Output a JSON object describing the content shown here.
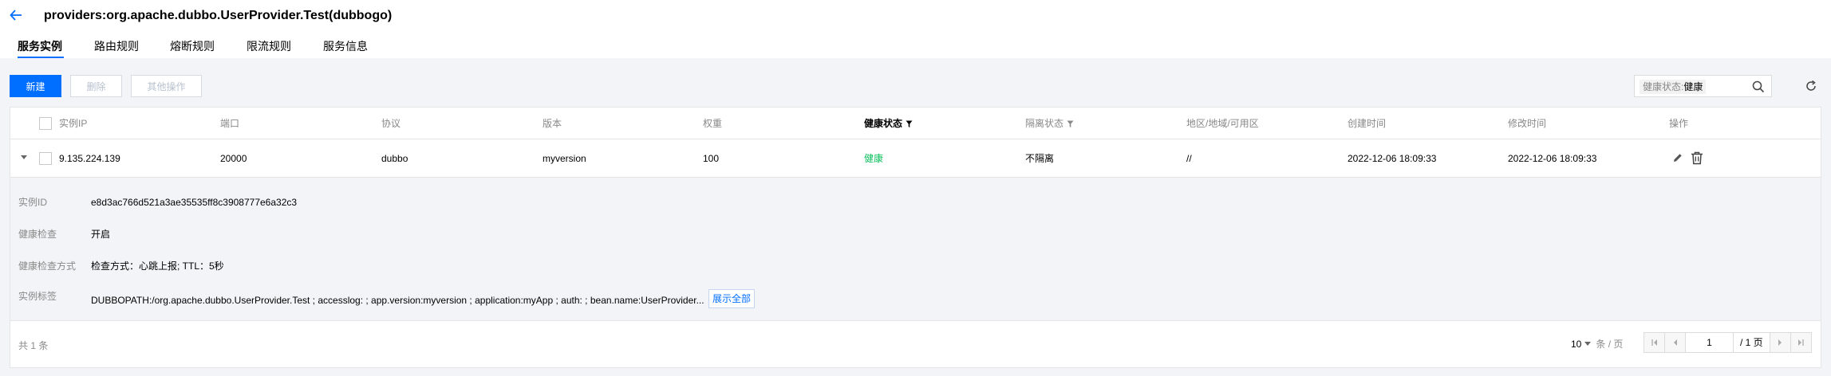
{
  "header": {
    "title": "providers:org.apache.dubbo.UserProvider.Test(dubbogo)",
    "back_icon": "arrow-left-icon"
  },
  "tabs": [
    {
      "label": "服务实例",
      "active": true
    },
    {
      "label": "路由规则",
      "active": false
    },
    {
      "label": "熔断规则",
      "active": false
    },
    {
      "label": "限流规则",
      "active": false
    },
    {
      "label": "服务信息",
      "active": false
    }
  ],
  "toolbar": {
    "new_label": "新建",
    "delete_label": "删除",
    "more_label": "其他操作"
  },
  "search": {
    "tag_key": "健康状态:",
    "tag_value": "健康"
  },
  "table": {
    "columns": [
      "实例IP",
      "端口",
      "协议",
      "版本",
      "权重",
      "健康状态",
      "隔离状态",
      "地区/地域/可用区",
      "创建时间",
      "修改时间",
      "操作"
    ],
    "rows": [
      {
        "ip": "9.135.224.139",
        "port": "20000",
        "protocol": "dubbo",
        "version": "myversion",
        "weight": "100",
        "health": "健康",
        "isolate": "不隔离",
        "region": "//",
        "created": "2022-12-06 18:09:33",
        "modified": "2022-12-06 18:09:33"
      }
    ],
    "detail": {
      "id_label": "实例ID",
      "id_value": "e8d3ac766d521a3ae35535ff8c3908777e6a32c3",
      "health_check_label": "健康检查",
      "health_check_value": "开启",
      "health_method_label": "健康检查方式",
      "health_method_value": "检查方式：心跳上报; TTL：5秒",
      "tags_label": "实例标签",
      "tags_value": "DUBBOPATH:/org.apache.dubbo.UserProvider.Test ; accesslog: ; app.version:myversion ; application:myApp ; auth: ; bean.name:UserProvider...",
      "show_all_label": "展示全部"
    }
  },
  "footer": {
    "total": "共 1 条",
    "page_size": "10",
    "page_size_unit": "条 / 页",
    "page_input": "1",
    "page_total": "/ 1 页"
  },
  "colors": {
    "primary": "#006eff",
    "healthy": "#0abf5b"
  }
}
